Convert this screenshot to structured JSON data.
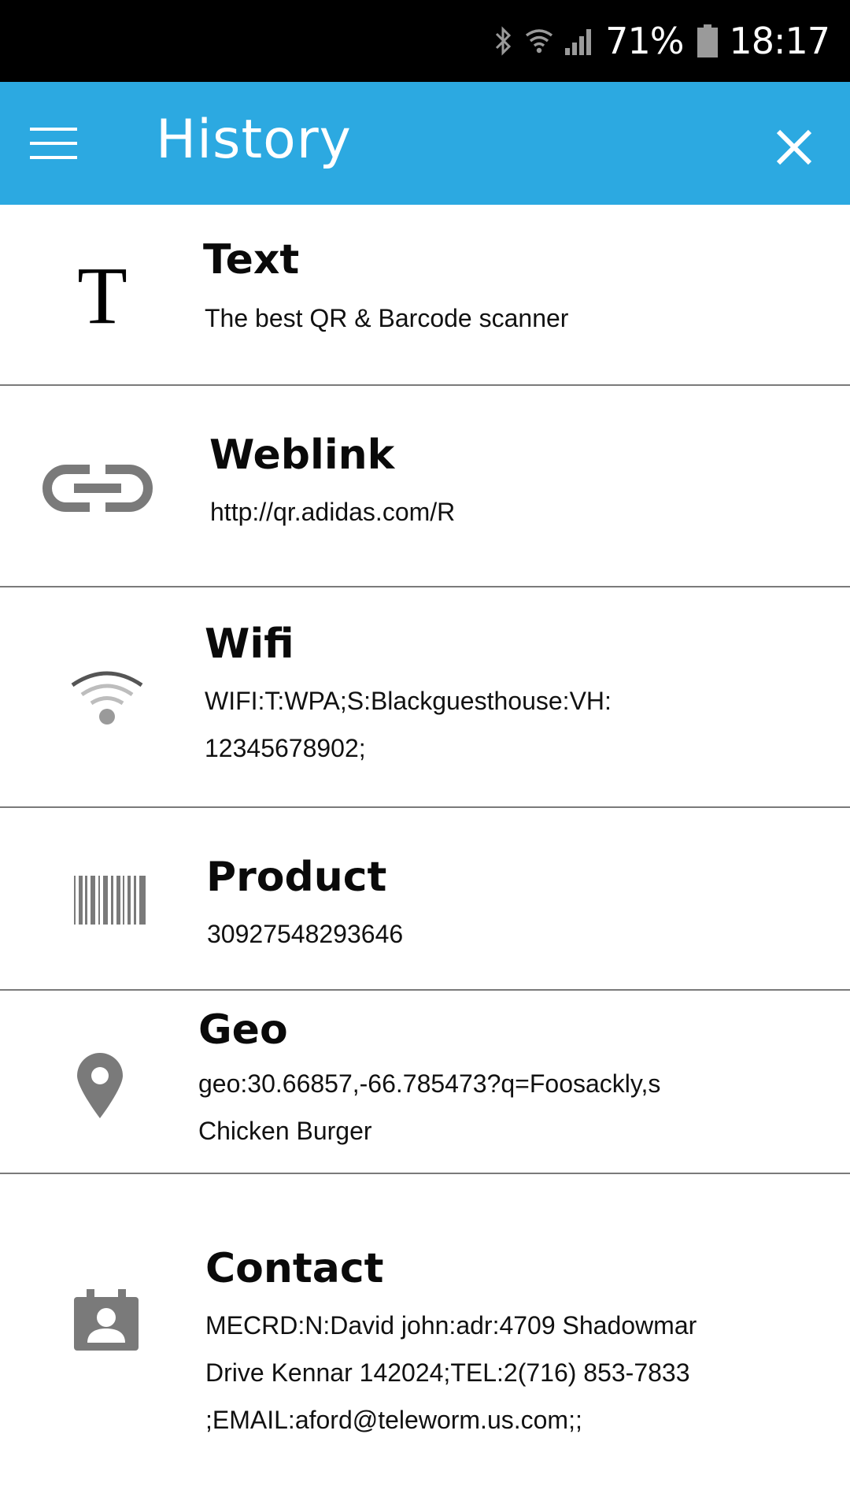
{
  "status_bar": {
    "battery_percent": "71%",
    "time": "18:17"
  },
  "app_bar": {
    "title": "History"
  },
  "history": [
    {
      "type": "Text",
      "value": "The best QR & Barcode scanner",
      "icon": "text-icon"
    },
    {
      "type": "Weblink",
      "value": "http://qr.adidas.com/R",
      "icon": "link-icon"
    },
    {
      "type": "Wifi",
      "value": "WIFI:T:WPA;S:Blackguesthouse:VH:\n12345678902;",
      "icon": "wifi-icon"
    },
    {
      "type": "Product",
      "value": "30927548293646",
      "icon": "barcode-icon"
    },
    {
      "type": "Geo",
      "value": "geo:30.66857,-66.785473?q=Foosackly,s\nChicken Burger",
      "icon": "location-pin-icon"
    },
    {
      "type": "Contact",
      "value": "MECRD:N:David john:adr:4709 Shadowmar\nDrive Kennar 142024;TEL:2(716) 853-7833\n;EMAIL:aford@teleworm.us.com;;",
      "icon": "contact-card-icon"
    }
  ],
  "colors": {
    "app_bar": "#2ca9e1",
    "status_bar": "#000000",
    "icon_gray": "#7a7a7a",
    "divider": "#7a7a7a"
  }
}
